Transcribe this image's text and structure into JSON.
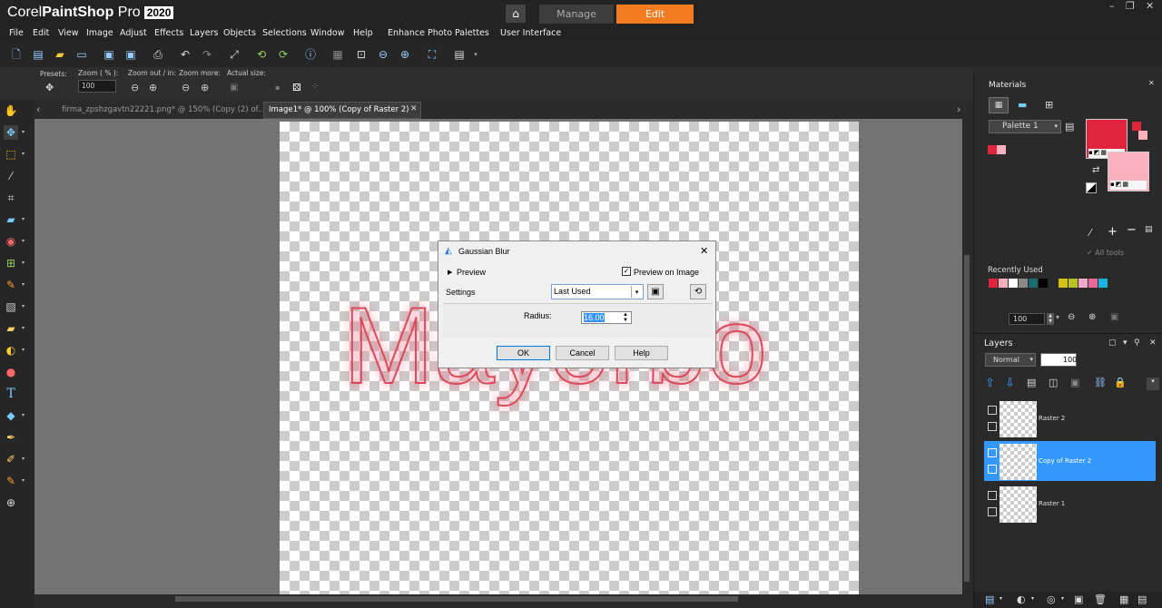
{
  "app": {
    "brand": "Corel",
    "product": "PaintShop",
    "pro": "Pro",
    "version": "2020"
  },
  "workspace_tabs": {
    "manage": "Manage",
    "edit": "Edit"
  },
  "menu": [
    "File",
    "Edit",
    "View",
    "Image",
    "Adjust",
    "Effects",
    "Layers",
    "Objects",
    "Selections",
    "Window",
    "Help",
    "Enhance Photo",
    "Palettes",
    "User Interface"
  ],
  "toolbar2": {
    "presets": "Presets:",
    "zoom_label": "Zoom ( % ):",
    "zoom_value": "100",
    "zoom_out_in": "Zoom out / in:",
    "zoom_more": "Zoom more:",
    "actual_size": "Actual size:"
  },
  "doc_tabs": [
    {
      "label": "firma_zpshzgavtn22221.png* @ 150% (Copy (2) of..."
    },
    {
      "label": "Image1* @ 100% (Copy of Raster 2)"
    }
  ],
  "canvas_text": "Mayorbo",
  "dialog": {
    "title": "Gaussian Blur",
    "preview": "Preview",
    "preview_on_image": "Preview on Image",
    "settings": "Settings",
    "settings_value": "Last Used",
    "radius_label": "Radius:",
    "radius_value": "16.00",
    "ok": "OK",
    "cancel": "Cancel",
    "help": "Help"
  },
  "materials": {
    "title": "Materials",
    "palette": "Palette 1",
    "all_tools": "All tools",
    "recently_used": "Recently Used",
    "opacity_value": "100",
    "fg_color": "#e0243d",
    "bg_color": "#f7b0bc"
  },
  "recent_colors": [
    "#e0243d",
    "#f7b0bc",
    "#ffffff",
    "#8a8a8a",
    "#1a6b6b",
    "#000000",
    "#2a2a2a",
    "#d4c01a",
    "#b8c41e",
    "#f2a8c8",
    "#e86a9a",
    "#1ab4e0"
  ],
  "layers": {
    "title": "Layers",
    "blend": "Normal",
    "opacity": "100",
    "items": [
      {
        "name": "Raster 2",
        "selected": false
      },
      {
        "name": "Copy of Raster 2",
        "selected": true
      },
      {
        "name": "Raster 1",
        "selected": false
      }
    ]
  }
}
